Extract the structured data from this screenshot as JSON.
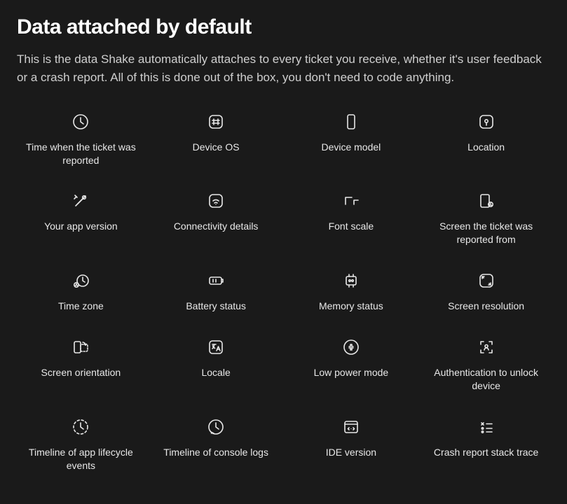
{
  "header": {
    "title": "Data attached by default",
    "subtitle": "This is the data Shake automatically attaches to every ticket you receive, whether it's user feedback or a crash report. All of this is done out of the box, you don't need to code anything."
  },
  "items": [
    {
      "icon": "clock-icon",
      "label": "Time when the ticket was reported"
    },
    {
      "icon": "hash-icon",
      "label": "Device OS"
    },
    {
      "icon": "device-icon",
      "label": "Device model"
    },
    {
      "icon": "pin-icon",
      "label": "Location"
    },
    {
      "icon": "tools-icon",
      "label": "Your app version"
    },
    {
      "icon": "wifi-icon",
      "label": "Connectivity details"
    },
    {
      "icon": "font-scale-icon",
      "label": "Font scale"
    },
    {
      "icon": "screen-report-icon",
      "label": "Screen the ticket was reported from"
    },
    {
      "icon": "timezone-icon",
      "label": "Time zone"
    },
    {
      "icon": "battery-icon",
      "label": "Battery status"
    },
    {
      "icon": "memory-icon",
      "label": "Memory status"
    },
    {
      "icon": "resolution-icon",
      "label": "Screen resolution"
    },
    {
      "icon": "orientation-icon",
      "label": "Screen orientation"
    },
    {
      "icon": "locale-icon",
      "label": "Locale"
    },
    {
      "icon": "low-power-icon",
      "label": "Low power mode"
    },
    {
      "icon": "auth-icon",
      "label": "Authentication to unlock device"
    },
    {
      "icon": "lifecycle-icon",
      "label": "Timeline of app lifecycle events"
    },
    {
      "icon": "console-log-icon",
      "label": "Timeline of console logs"
    },
    {
      "icon": "ide-icon",
      "label": "IDE version"
    },
    {
      "icon": "stacktrace-icon",
      "label": "Crash report stack trace"
    }
  ]
}
